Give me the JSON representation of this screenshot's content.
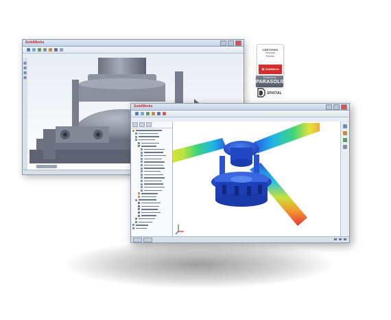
{
  "back_window": {
    "title_logo": "SolidWorks",
    "icons": [
      "model-icon",
      "ribbon-icons"
    ]
  },
  "front_window": {
    "title_logo": "SolidWorks",
    "viewport": {
      "legend_present": false
    }
  },
  "badges": {
    "certified": {
      "line1": "CERTIFIED",
      "line2": "Solution",
      "line3": "Partner",
      "logo_text": "SolidWorks"
    },
    "parasolid": {
      "small_text": "Powered by",
      "big_text": "PARASOLID"
    },
    "spatial": {
      "text": "SPATIAL"
    }
  },
  "colors": {
    "accent_red": "#d32f2f",
    "model_gray": "#7e8191",
    "fea_blue": "#1f4fd6",
    "fea_red": "#e53935"
  }
}
